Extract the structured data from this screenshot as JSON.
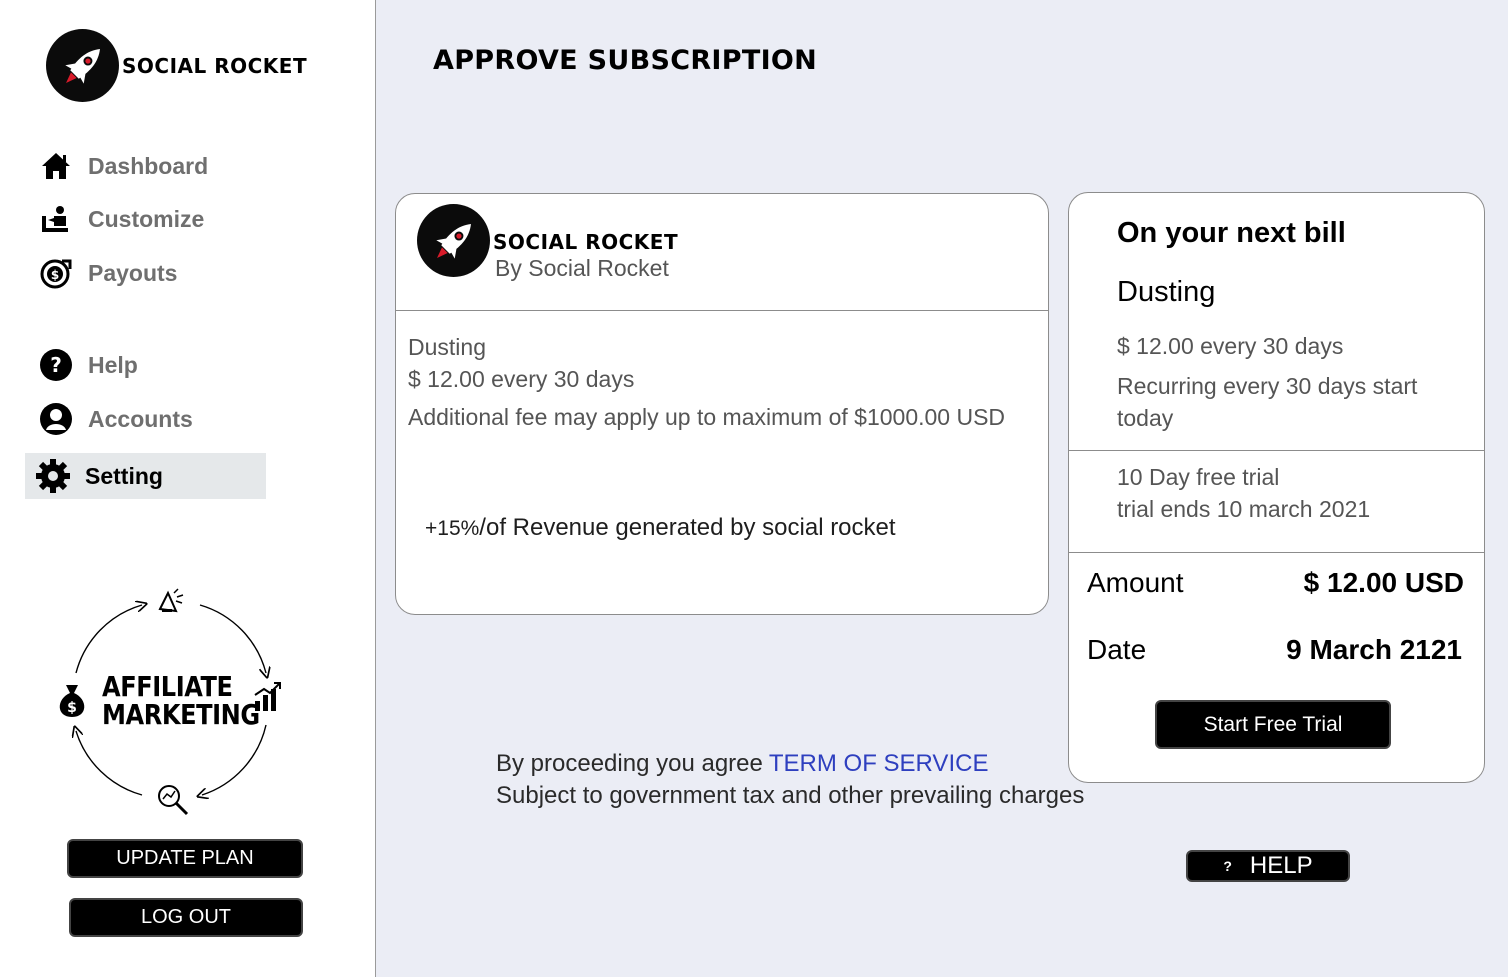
{
  "brand": {
    "name": "SOCIAL ROCKET"
  },
  "sidebar": {
    "items": [
      {
        "label": "Dashboard",
        "icon": "home-icon"
      },
      {
        "label": "Customize",
        "icon": "customize-icon"
      },
      {
        "label": "Payouts",
        "icon": "payouts-icon"
      },
      {
        "label": "Help",
        "icon": "question-icon"
      },
      {
        "label": "Accounts",
        "icon": "user-icon"
      },
      {
        "label": "Setting",
        "icon": "gear-icon",
        "active": true
      }
    ],
    "affiliate": {
      "line1": "AFFILIATE",
      "line2": "MARKETING"
    },
    "update_plan": "UPDATE PLAN",
    "log_out": "LOG OUT"
  },
  "page": {
    "title": "APPROVE SUBSCRIPTION"
  },
  "subscription_card": {
    "brand_name": "SOCIAL ROCKET",
    "brand_by": "By Social Rocket",
    "plan": "Dusting",
    "price": "$ 12.00 every 30 days",
    "fee_note": "Additional fee may apply up to maximum of $1000.00 USD",
    "revenue_pct": "+15%",
    "revenue_text": "/of Revenue generated by social rocket"
  },
  "bill": {
    "heading": "On your next bill",
    "plan": "Dusting",
    "price": "$ 12.00 every 30 days",
    "recurring_1": "Recurring every 30 days start",
    "recurring_2": "today",
    "trial": "10 Day free trial",
    "trial_end": "trial ends 10 march 2021",
    "amount_label": "Amount",
    "amount_value": "$ 12.00 USD",
    "date_label": "Date",
    "date_value": "9 March 2121",
    "cta": "Start Free Trial"
  },
  "agreement": {
    "prefix": "By proceeding you agree",
    "tos": "TERM OF SERVICE",
    "tax_note": "Subject to government tax and other prevailing charges"
  },
  "help_button": {
    "mark": "?",
    "label": "HELP"
  },
  "colors": {
    "link": "#2e3fbf",
    "page_bg": "#ebedf5",
    "active_nav": "#e5e8ea"
  }
}
